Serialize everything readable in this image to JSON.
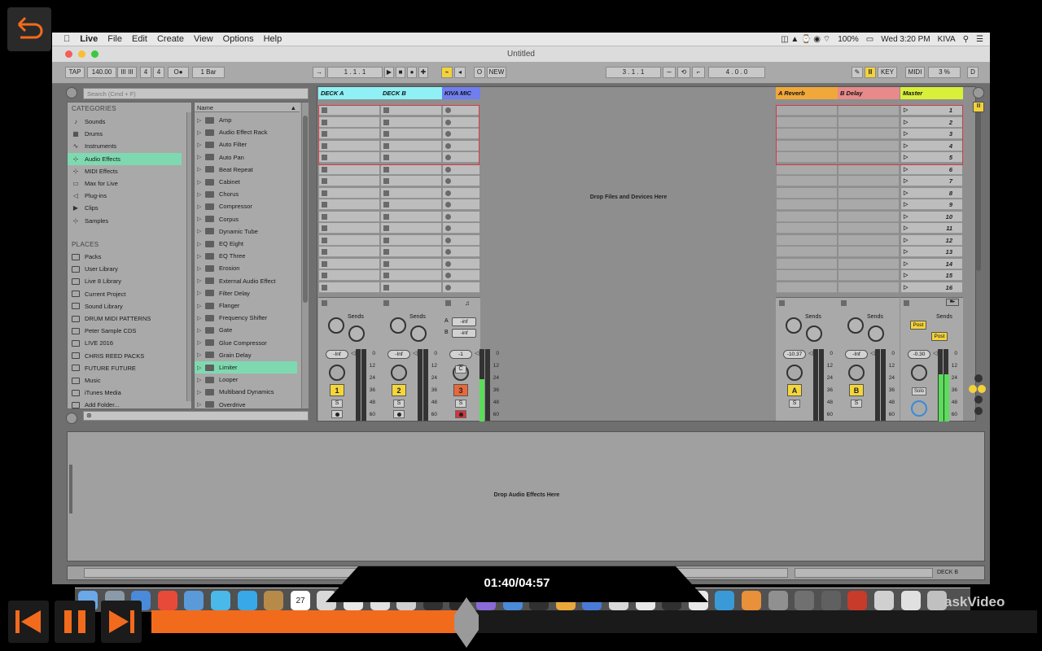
{
  "menubar": {
    "apple": "",
    "app": "Live",
    "items": [
      "File",
      "Edit",
      "Create",
      "View",
      "Options",
      "Help"
    ],
    "battery": "100%",
    "clock": "Wed 3:20 PM",
    "user": "KIVA"
  },
  "window": {
    "title": "Untitled"
  },
  "control_bar": {
    "tap": "TAP",
    "tempo": "140.00",
    "signature_num": "4",
    "signature_den": "4",
    "quantize": "1 Bar",
    "position": "1 .  1 .  1",
    "new": "NEW",
    "loop_start": "3 .  1 .  1",
    "loop_length": "4 .  0 .  0",
    "key": "KEY",
    "midi": "MIDI",
    "cpu": "3 %",
    "d": "D"
  },
  "browser": {
    "search_placeholder": "Search (Cmd + F)",
    "categories_label": "CATEGORIES",
    "categories": [
      {
        "label": "Sounds",
        "icon": "♪"
      },
      {
        "label": "Drums",
        "icon": "▦"
      },
      {
        "label": "Instruments",
        "icon": "∿"
      },
      {
        "label": "Audio Effects",
        "icon": "⊹"
      },
      {
        "label": "MIDI Effects",
        "icon": "⊹"
      },
      {
        "label": "Max for Live",
        "icon": "▭"
      },
      {
        "label": "Plug-ins",
        "icon": "◁"
      },
      {
        "label": "Clips",
        "icon": "▶"
      },
      {
        "label": "Samples",
        "icon": "⊹"
      }
    ],
    "places_label": "PLACES",
    "places": [
      "Packs",
      "User Library",
      "Live 8 Library",
      "Current Project",
      "Sound Library",
      "DRUM MIDI PATTERNS",
      "Peter Sample CDS",
      "LIVE 2016",
      "CHRIS REED PACKS",
      "FUTURE FUTURE",
      "Music",
      "iTunes Media",
      "Add Folder..."
    ],
    "name_header": "Name",
    "items": [
      "Amp",
      "Audio Effect Rack",
      "Auto Filter",
      "Auto Pan",
      "Beat Repeat",
      "Cabinet",
      "Chorus",
      "Compressor",
      "Corpus",
      "Dynamic Tube",
      "EQ Eight",
      "EQ Three",
      "Erosion",
      "External Audio Effect",
      "Filter Delay",
      "Flanger",
      "Frequency Shifter",
      "Gate",
      "Glue Compressor",
      "Grain Delay",
      "Limiter",
      "Looper",
      "Multiband Dynamics",
      "Overdrive"
    ]
  },
  "session": {
    "tracks": [
      {
        "name": "DECK A",
        "color": "#8ff0f5",
        "number": "1",
        "vol": "-Inf",
        "numcolor": "#f5d63a",
        "solo": "S"
      },
      {
        "name": "DECK B",
        "color": "#8ff0f5",
        "number": "2",
        "vol": "-Inf",
        "numcolor": "#f5d63a",
        "solo": "S"
      },
      {
        "name": "KIVA MIC",
        "color": "#6f7ff0",
        "number": "3",
        "vol": "-1",
        "numcolor": "#e8683a",
        "solo": "S"
      }
    ],
    "drop_files": "Drop Files and Devices Here",
    "returns": [
      {
        "name": "A Reverb",
        "color": "#f0a83a",
        "letter": "A",
        "vol": "-10.37",
        "solo": "S"
      },
      {
        "name": "B Delay",
        "color": "#e88a8a",
        "letter": "B",
        "vol": "-Inf",
        "solo": "S"
      }
    ],
    "master": {
      "name": "Master",
      "color": "#d8f03a",
      "vol": "-0.30",
      "post1": "Post",
      "post2": "Post",
      "solo_label": "Solo"
    },
    "scenes": [
      "1",
      "2",
      "3",
      "4",
      "5",
      "6",
      "7",
      "8",
      "9",
      "10",
      "11",
      "12",
      "13",
      "14",
      "15",
      "16"
    ],
    "sends_label": "Sends",
    "send_a": "A",
    "send_b": "B",
    "mic_send_a": "-inf",
    "mic_send_b": "-inf",
    "c_label": "C",
    "scale": [
      "0",
      "12",
      "24",
      "36",
      "48",
      "60"
    ]
  },
  "device_view": {
    "drop": "Drop Audio Effects Here",
    "track_label": "DECK B"
  },
  "player": {
    "time": "01:40/04:57",
    "progress": 0.29,
    "brand": "askVideo"
  },
  "dock": {
    "calendar_day": "27"
  }
}
